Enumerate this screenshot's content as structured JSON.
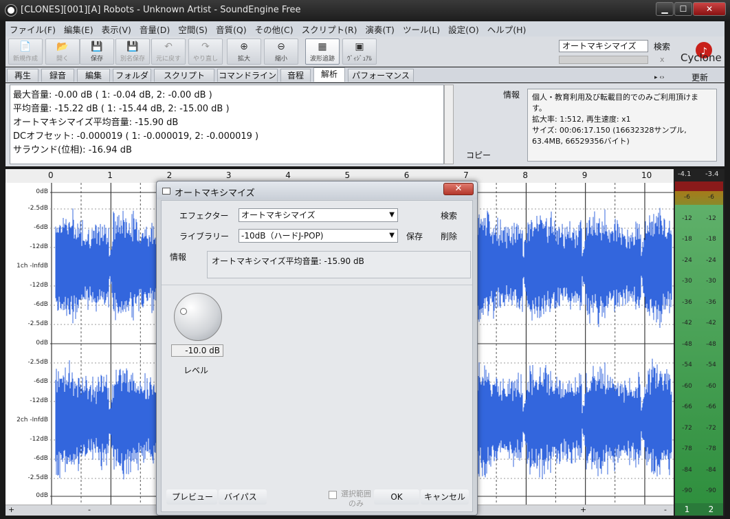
{
  "window": {
    "title": "[CLONES][001][A] Robots - Unknown Artist - SoundEngine Free",
    "minimize": "▁",
    "maximize": "☐",
    "close": "✕"
  },
  "menu": [
    "ファイル(F)",
    "編集(E)",
    "表示(V)",
    "音量(D)",
    "空間(S)",
    "音質(Q)",
    "その他(C)",
    "スクリプト(R)",
    "演奏(T)",
    "ツール(L)",
    "設定(O)",
    "ヘルプ(H)"
  ],
  "toolbar": [
    {
      "label": "新規作成",
      "icon": "📄",
      "disabled": true
    },
    {
      "label": "開く",
      "icon": "📂",
      "disabled": true
    },
    {
      "label": "保存",
      "icon": "💾",
      "disabled": false
    },
    {
      "label": "別名保存",
      "icon": "💾",
      "disabled": true
    },
    {
      "label": "元に戻す",
      "icon": "↶",
      "disabled": true
    },
    {
      "label": "やり直し",
      "icon": "↷",
      "disabled": true
    },
    {
      "label": "拡大",
      "icon": "⊕",
      "disabled": false
    },
    {
      "label": "縮小",
      "icon": "⊖",
      "disabled": false
    },
    {
      "label": "波形追跡",
      "icon": "▦",
      "disabled": false,
      "active": true
    },
    {
      "label": "ｳﾞｨｼﾞｭｱﾙ",
      "icon": "▣",
      "disabled": false
    }
  ],
  "search": {
    "value": "オートマキシマイズ",
    "button": "検索",
    "clear": "x"
  },
  "logo": {
    "text": "Cyclone 5th"
  },
  "tabs": [
    "再生",
    "録音",
    "編集",
    "フォルダ",
    "スクリプト",
    "コマンドライン",
    "音程",
    "解析",
    "パフォーマンス"
  ],
  "active_tab": "解析",
  "update_button": "更新",
  "nav_icons": "▸ ‹›",
  "analysis": {
    "lines": [
      "最大音量: -0.00 dB ( 1: -0.04 dB, 2: -0.00 dB )",
      "平均音量: -15.22 dB ( 1: -15.44 dB, 2: -15.00 dB )",
      "オートマキシマイズ平均音量: -15.90 dB",
      "DCオフセット: -0.000019 ( 1: -0.000019, 2: -0.000019 )",
      "サラウンド(位相): -16.94 dB"
    ],
    "info_label": "情報",
    "copy_button": "コピー",
    "license_lines": [
      "個人・教育利用及び転載目的でのみご利用頂けま",
      "す。",
      "拡大率: 1:512, 再生速度: x1",
      "サイズ: 00:06:17.150 (16632328サンプル,",
      "63.4MB, 66529356バイト)"
    ]
  },
  "ruler": [
    "0",
    "1",
    "2",
    "3",
    "4",
    "5",
    "6",
    "7",
    "8",
    "9",
    "10"
  ],
  "db_labels": [
    "0dB",
    "-2.5dB",
    "-6dB",
    "-12dB",
    "1ch -InfdB",
    "-12dB",
    "-6dB",
    "-2.5dB",
    "0dB",
    "-2.5dB",
    "-6dB",
    "-12dB",
    "2ch -InfdB",
    "-12dB",
    "-6dB",
    "-2.5dB",
    "0dB"
  ],
  "meter": {
    "peak_left": "-4.1",
    "peak_right": "-3.4",
    "scale": [
      "-6",
      "-12",
      "-18",
      "-24",
      "-30",
      "-36",
      "-42",
      "-48",
      "-54",
      "-60",
      "-66",
      "-72",
      "-78",
      "-84",
      "-90"
    ],
    "channels": [
      "1",
      "2"
    ]
  },
  "colors": {
    "waveform": "#3366dd",
    "meter_green": "#2f8f3e",
    "meter_red": "#8a1a1a"
  },
  "scroll": {
    "plus": "+",
    "minus": "-"
  },
  "dialog": {
    "title": "オートマキシマイズ",
    "close": "✕",
    "effector_label": "エフェクター",
    "effector_value": "オートマキシマイズ",
    "search_button": "検索",
    "library_label": "ライブラリー",
    "library_value": "-10dB（ハードJ-POP)",
    "save_button": "保存",
    "delete_button": "削除",
    "info_label": "情報",
    "info_text": "オートマキシマイズ平均音量: -15.90 dB",
    "level_value": "-10.0 dB",
    "level_fraction": 0.25,
    "level_label": "レベル",
    "preview_button": "プレビュー",
    "bypass_button": "バイパス",
    "selection_only_label": "選択範囲のみ",
    "ok_button": "OK",
    "cancel_button": "キャンセル"
  }
}
